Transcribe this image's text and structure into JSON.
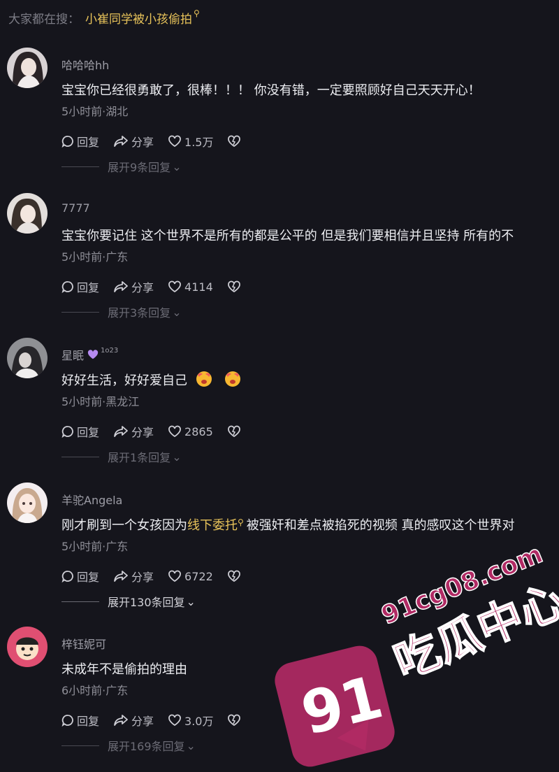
{
  "search": {
    "prefix": "大家都在搜：",
    "term": "小崔同学被小孩偷拍"
  },
  "labels": {
    "reply": "回复",
    "share": "分享"
  },
  "comments": [
    {
      "username": "哈哈哈hh",
      "content": "宝宝你已经很勇敢了，很棒！！！ 你没有错，一定要照顾好自己天天开心！",
      "meta": "5小时前·湖北",
      "likes": "1.5万",
      "expand": "展开9条回复"
    },
    {
      "username": "7777",
      "content": "宝宝你要记住 这个世界不是所有的都是公平的 但是我们要相信并且坚持 所有的不",
      "meta": "5小时前·广东",
      "likes": "4114",
      "expand": "展开3条回复"
    },
    {
      "username": "星眠",
      "badge_sup": "1o23",
      "content": "好好生活，好好爱自己",
      "meta": "5小时前·黑龙江",
      "likes": "2865",
      "expand": "展开1条回复"
    },
    {
      "username": "羊驼Angela",
      "content_pre": "刚才刷到一个女孩因为",
      "content_link": "线下委托",
      "content_post": "被强奸和差点被掐死的视频 真的感叹这个世界对",
      "meta": "5小时前·广东",
      "likes": "6722",
      "expand": "展开130条回复"
    },
    {
      "username": "梓钰妮可",
      "content": "未成年不是偷拍的理由",
      "meta": "6小时前·广东",
      "likes": "3.0万",
      "expand": "展开169条回复"
    }
  ],
  "watermark": {
    "number": "91",
    "domain": "91cg08.com",
    "brand": "吃瓜中心"
  }
}
